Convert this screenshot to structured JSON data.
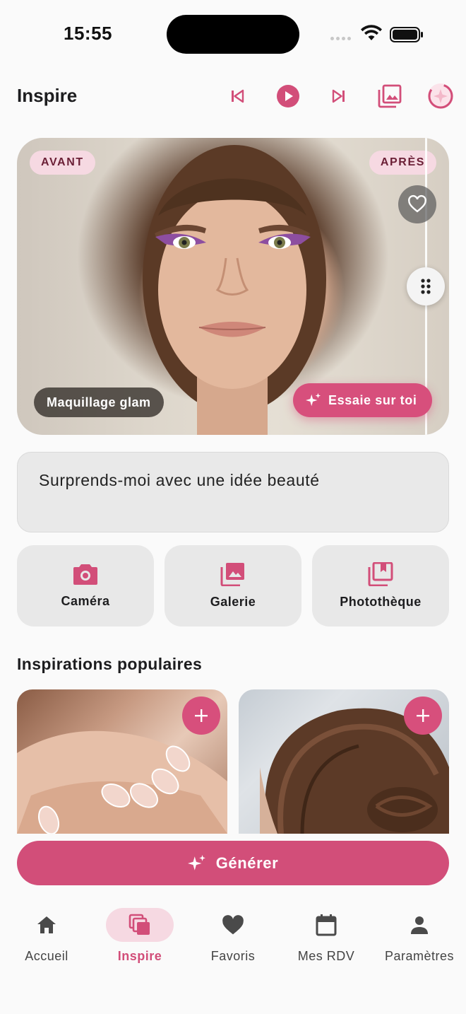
{
  "status": {
    "time": "15:55"
  },
  "header": {
    "title": "Inspire"
  },
  "hero": {
    "before_tag": "AVANT",
    "after_tag": "APRÈS",
    "look_label": "Maquillage glam",
    "try_button": "Essaie sur toi"
  },
  "prompt": {
    "text": "Surprends-moi avec une idée beauté"
  },
  "sources": [
    {
      "label": "Caméra",
      "icon": "camera-icon"
    },
    {
      "label": "Galerie",
      "icon": "gallery-icon"
    },
    {
      "label": "Photothèque",
      "icon": "photo-library-icon"
    }
  ],
  "popular": {
    "title": "Inspirations populaires",
    "cards": [
      {
        "subject": "french-manicure-nails"
      },
      {
        "subject": "braided-bun-hairstyle"
      }
    ]
  },
  "generate_button": "Générer",
  "nav": [
    {
      "label": "Accueil",
      "icon": "home-icon",
      "active": false
    },
    {
      "label": "Inspire",
      "icon": "inspire-icon",
      "active": true
    },
    {
      "label": "Favoris",
      "icon": "heart-icon",
      "active": false
    },
    {
      "label": "Mes RDV",
      "icon": "calendar-icon",
      "active": false
    },
    {
      "label": "Paramètres",
      "icon": "person-icon",
      "active": false
    }
  ],
  "colors": {
    "accent": "#d24e79",
    "accent_light": "#f6d9e2",
    "surface": "#e8e8e8",
    "background": "#fafafa"
  }
}
